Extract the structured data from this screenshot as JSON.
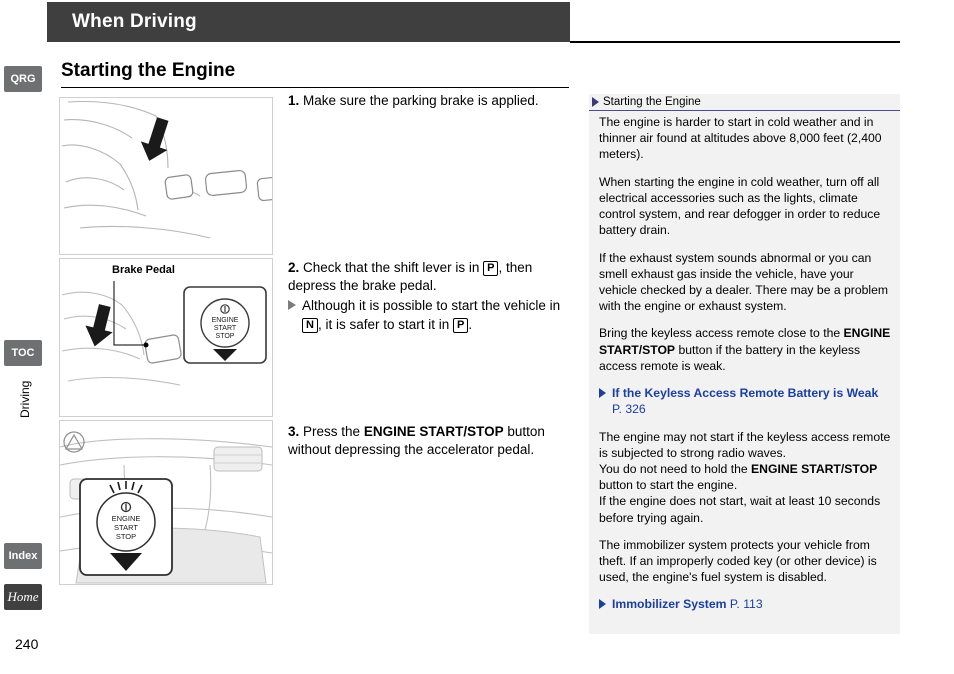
{
  "header": {
    "title": "When Driving"
  },
  "side_tabs": {
    "qrg": "QRG",
    "toc": "TOC",
    "index": "Index",
    "home": "Home",
    "vertical_label": "Driving"
  },
  "section": {
    "title": "Starting the Engine"
  },
  "figures": {
    "fig1_caption": "",
    "fig2_caption": "Brake Pedal",
    "engine_button_label_line1": "ENGINE",
    "engine_button_label_line2": "START",
    "engine_button_label_line3": "STOP"
  },
  "steps": [
    {
      "num": "1.",
      "text": "Make sure the parking brake is applied."
    },
    {
      "num": "2.",
      "text_a": "Check that the shift lever is in",
      "key_a": "P",
      "text_b": ", then depress the brake pedal.",
      "sub_a": "Although it is possible to start the vehicle in",
      "sub_key_a": "N",
      "sub_b": ", it is safer to start it in",
      "sub_key_b": "P",
      "sub_c": "."
    },
    {
      "num": "3.",
      "text_a": "Press the",
      "bold": "ENGINE START/STOP",
      "text_b": "button without depressing the accelerator pedal."
    }
  ],
  "info_panel": {
    "header_title": "Starting the Engine",
    "paragraphs": [
      "The engine is harder to start in cold weather and in thinner air found at altitudes above 8,000 feet (2,400 meters).",
      "When starting the engine in cold weather, turn off all electrical accessories such as the lights, climate control system, and rear defogger in order to reduce battery drain.",
      "If the exhaust system sounds abnormal or you can smell exhaust gas inside the vehicle, have your vehicle checked by a dealer. There may be a problem with the engine or exhaust system."
    ],
    "keyless_para_a": "Bring the keyless access remote close to the",
    "keyless_bold": "ENGINE START/STOP",
    "keyless_para_b": "button if the battery in the keyless access remote is weak.",
    "link1_text": "If the Keyless Access Remote Battery is Weak",
    "link1_page": "P. 326",
    "after_link_paragraphs": [
      "The engine may not start if the keyless access remote is subjected to strong radio waves."
    ],
    "hold_para_a": "You do not need to hold the",
    "hold_bold": "ENGINE START/STOP",
    "hold_para_b": "button to start the engine.",
    "restart_para": "If the engine does not start, wait at least 10 seconds before trying again.",
    "immobilizer_para": "The immobilizer system protects your vehicle from theft. If an improperly coded key (or other device) is used, the engine's fuel system is disabled.",
    "link2_text": "Immobilizer System",
    "link2_page": "P. 113"
  },
  "page_number": "240"
}
